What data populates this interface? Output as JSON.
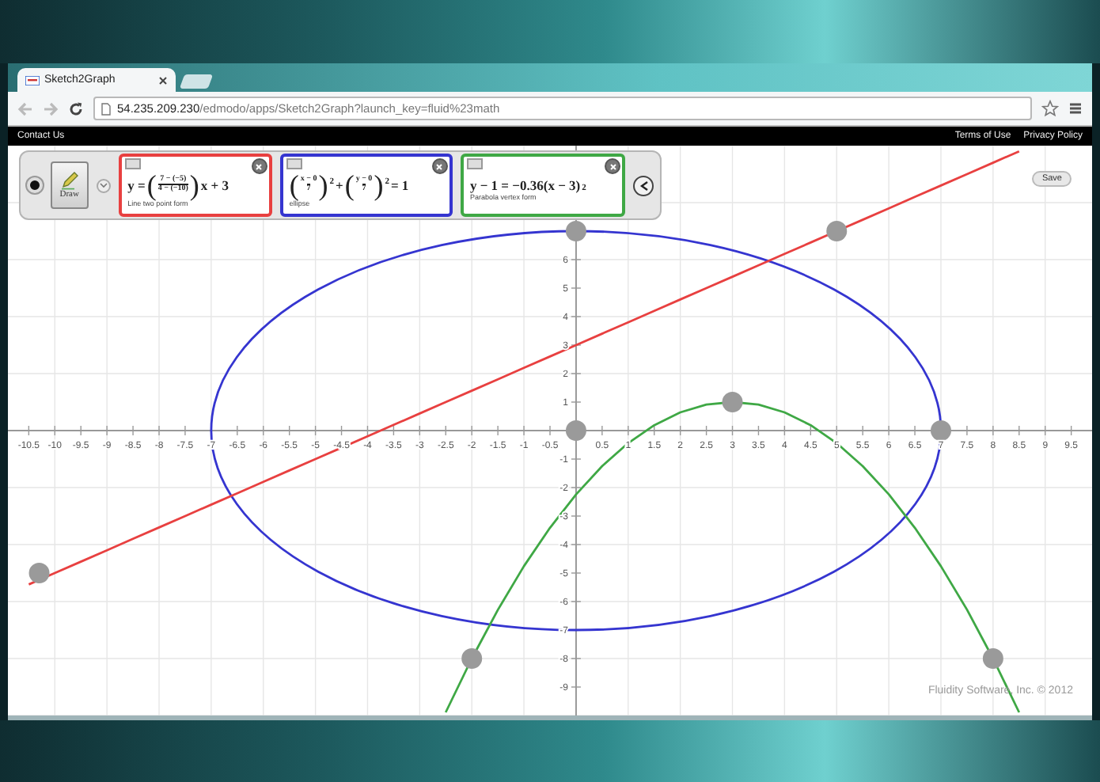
{
  "browser": {
    "tab": {
      "title": "Sketch2Graph"
    },
    "url": "**54.235.209.230**/edmodo/apps/Sketch2Graph?launch_key=fluid%23math"
  },
  "site_bar": {
    "left_links": [
      "Contact Us"
    ],
    "right_links": [
      "Terms of Use",
      "Privacy Policy"
    ]
  },
  "toolbar": {
    "draw_button": "Draw",
    "equations": [
      {
        "color": "#e84040",
        "caption": "Line two point form",
        "terms": [
          {
            "kind": "text",
            "text": "y ="
          },
          {
            "kind": "paren",
            "text": "("
          },
          {
            "kind": "frac",
            "num": "7 − (−5)",
            "den": "4 − (−10)"
          },
          {
            "kind": "paren",
            "text": ")"
          },
          {
            "kind": "text",
            "text": "x + 3"
          }
        ]
      },
      {
        "color": "#3535d0",
        "caption": "ellipse",
        "terms": [
          {
            "kind": "paren",
            "text": "("
          },
          {
            "kind": "frac",
            "num": "x − 0",
            "den": "7"
          },
          {
            "kind": "paren",
            "text": ")"
          },
          {
            "kind": "sup",
            "text": "2"
          },
          {
            "kind": "text",
            "text": "+"
          },
          {
            "kind": "paren",
            "text": "("
          },
          {
            "kind": "frac",
            "num": "y − 0",
            "den": "7"
          },
          {
            "kind": "paren",
            "text": ")"
          },
          {
            "kind": "sup",
            "text": "2"
          },
          {
            "kind": "text",
            "text": "= 1"
          }
        ]
      },
      {
        "color": "#3fa845",
        "caption": "Parabola vertex form",
        "terms": [
          {
            "kind": "text",
            "text": "y − 1 = −0.36(x − 3)"
          },
          {
            "kind": "sup",
            "text": "2"
          }
        ]
      }
    ]
  },
  "save_button": "Save",
  "graph": {
    "chart_data": {
      "type": "line",
      "grid": true,
      "x": [
        -10.5,
        -10,
        -9.5,
        -9,
        -8.5,
        -8,
        -7.5,
        -7,
        -6.5,
        -6,
        -5.5,
        -5,
        -4.5,
        -4,
        -3.5,
        -3,
        -2.5,
        -2,
        -1.5,
        -1,
        -0.5,
        0,
        0.5,
        1,
        1.5,
        2,
        2.5,
        3,
        3.5,
        4,
        4.5,
        5,
        5.5,
        6,
        6.5,
        7,
        7.5,
        8,
        8.5
      ],
      "series": [
        {
          "color": "#e84040",
          "values": [
            -5.4,
            -5,
            -4.6,
            -4.2,
            -3.8,
            -3.4,
            -3,
            -2.6,
            -2.2,
            -1.8,
            -1.4,
            -1,
            -0.6,
            -0.2,
            0.2,
            0.6,
            1,
            1.4,
            1.8,
            2.2,
            2.6,
            3,
            3.4,
            3.8,
            4.2,
            4.6,
            5,
            5.4,
            5.8,
            6.2,
            6.6,
            7,
            7.4,
            7.8,
            8.2,
            8.6,
            9,
            9.4,
            9.8
          ]
        },
        {
          "color": "#3fa845",
          "values": [
            null,
            null,
            null,
            null,
            null,
            null,
            null,
            null,
            null,
            null,
            null,
            null,
            null,
            null,
            null,
            null,
            -9.89,
            -8,
            -6.29,
            -4.76,
            -3.41,
            -2.24,
            -1.25,
            -0.44,
            0.19,
            0.64,
            0.91,
            1,
            0.91,
            0.64,
            0.19,
            -0.44,
            -1.25,
            -2.24,
            -3.41,
            -4.76,
            -6.29,
            -8,
            -9.89
          ]
        },
        {
          "type": "scatter",
          "color": "#9a9a9a",
          "x": [
            -10.3,
            5,
            0,
            0,
            3,
            7,
            -2,
            8
          ],
          "values": [
            -5,
            7,
            7,
            0,
            1,
            0,
            -8,
            -8
          ]
        }
      ],
      "xlim": [
        -10.9,
        9.9
      ],
      "ylim": [
        -10,
        10
      ],
      "xticks": [
        -10.5,
        -10,
        -9.5,
        -9,
        -8.5,
        -8,
        -7.5,
        -7,
        -6.5,
        -6,
        -5.5,
        -5,
        -4.5,
        -4,
        -3.5,
        -3,
        -2.5,
        -2,
        -1.5,
        -1,
        -0.5,
        0.5,
        1,
        1.5,
        2,
        2.5,
        3,
        3.5,
        4,
        4.5,
        5,
        5.5,
        6,
        6.5,
        7,
        7.5,
        8,
        8.5,
        9,
        9.5
      ],
      "yticks": [
        -9,
        -8,
        -7,
        -6,
        -5,
        -4,
        -3,
        -2,
        -1,
        1,
        2,
        3,
        4,
        5,
        6
      ]
    }
  },
  "footer": "Fluidity Software, Inc. © 2012"
}
